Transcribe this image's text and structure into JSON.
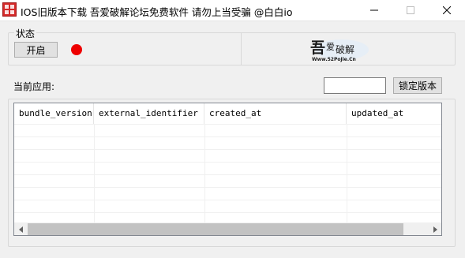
{
  "window": {
    "title": "IOS旧版本下载 吾爱破解论坛免费软件 请勿上当受骗 @白白io",
    "icon": "app-seal-icon",
    "controls": [
      "minimize-icon",
      "maximize-icon",
      "close-icon"
    ]
  },
  "status": {
    "group_label": "状态",
    "start_button": "开启",
    "indicator_color": "#ee0000"
  },
  "logo": {
    "main_text": "吾爱破解",
    "sub_text": "Www.52PoJie.Cn"
  },
  "app": {
    "current_label": "当前应用:",
    "version_input_value": "",
    "lock_button": "锁定版本"
  },
  "table": {
    "columns": [
      "bundle_version",
      "external_identifier",
      "created_at",
      "updated_at"
    ],
    "rows": []
  },
  "colors": {
    "indicator": "#ee0000",
    "icon_red": "#d42a2a"
  }
}
